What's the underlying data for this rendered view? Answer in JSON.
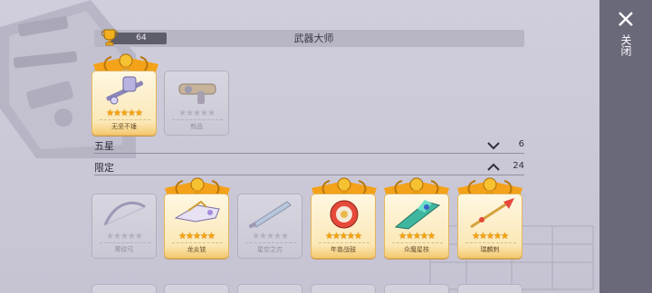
{
  "header": {
    "title": "武器大师",
    "score": "64"
  },
  "top_cards": [
    {
      "name": "无坚不锤",
      "stars": "★★★★★",
      "owned": true
    },
    {
      "name": "煎品",
      "stars": "★★★★★",
      "owned": false
    }
  ],
  "sections": [
    {
      "label": "五星",
      "count": "6",
      "state": "collapsed"
    },
    {
      "label": "限定",
      "count": "24",
      "state": "expanded"
    }
  ],
  "limited_cards": [
    {
      "name": "寄纹弓",
      "stars": "★★★★★",
      "owned": false
    },
    {
      "name": "龙炎铳",
      "stars": "★★★★★",
      "owned": true
    },
    {
      "name": "星空之刃",
      "stars": "★★★★★",
      "owned": false
    },
    {
      "name": "年兽战鼓",
      "stars": "★★★★★",
      "owned": true
    },
    {
      "name": "众魔星核",
      "stars": "★★★★★",
      "owned": true
    },
    {
      "name": "瑞麟刺",
      "stars": "★★★★★",
      "owned": true
    }
  ],
  "close": {
    "label": "关闭"
  },
  "colors": {
    "gold": "#f5a20d",
    "panel": "#6a6979",
    "header": "#b8b6c4"
  },
  "icons": [
    "trophy-icon",
    "laurel-icon",
    "chevron-down-icon",
    "chevron-up-icon",
    "close-icon",
    "hammer-icon",
    "gun-icon",
    "bow-icon",
    "blaster-icon",
    "blade-icon",
    "drum-icon",
    "crystal-icon",
    "spear-icon"
  ]
}
